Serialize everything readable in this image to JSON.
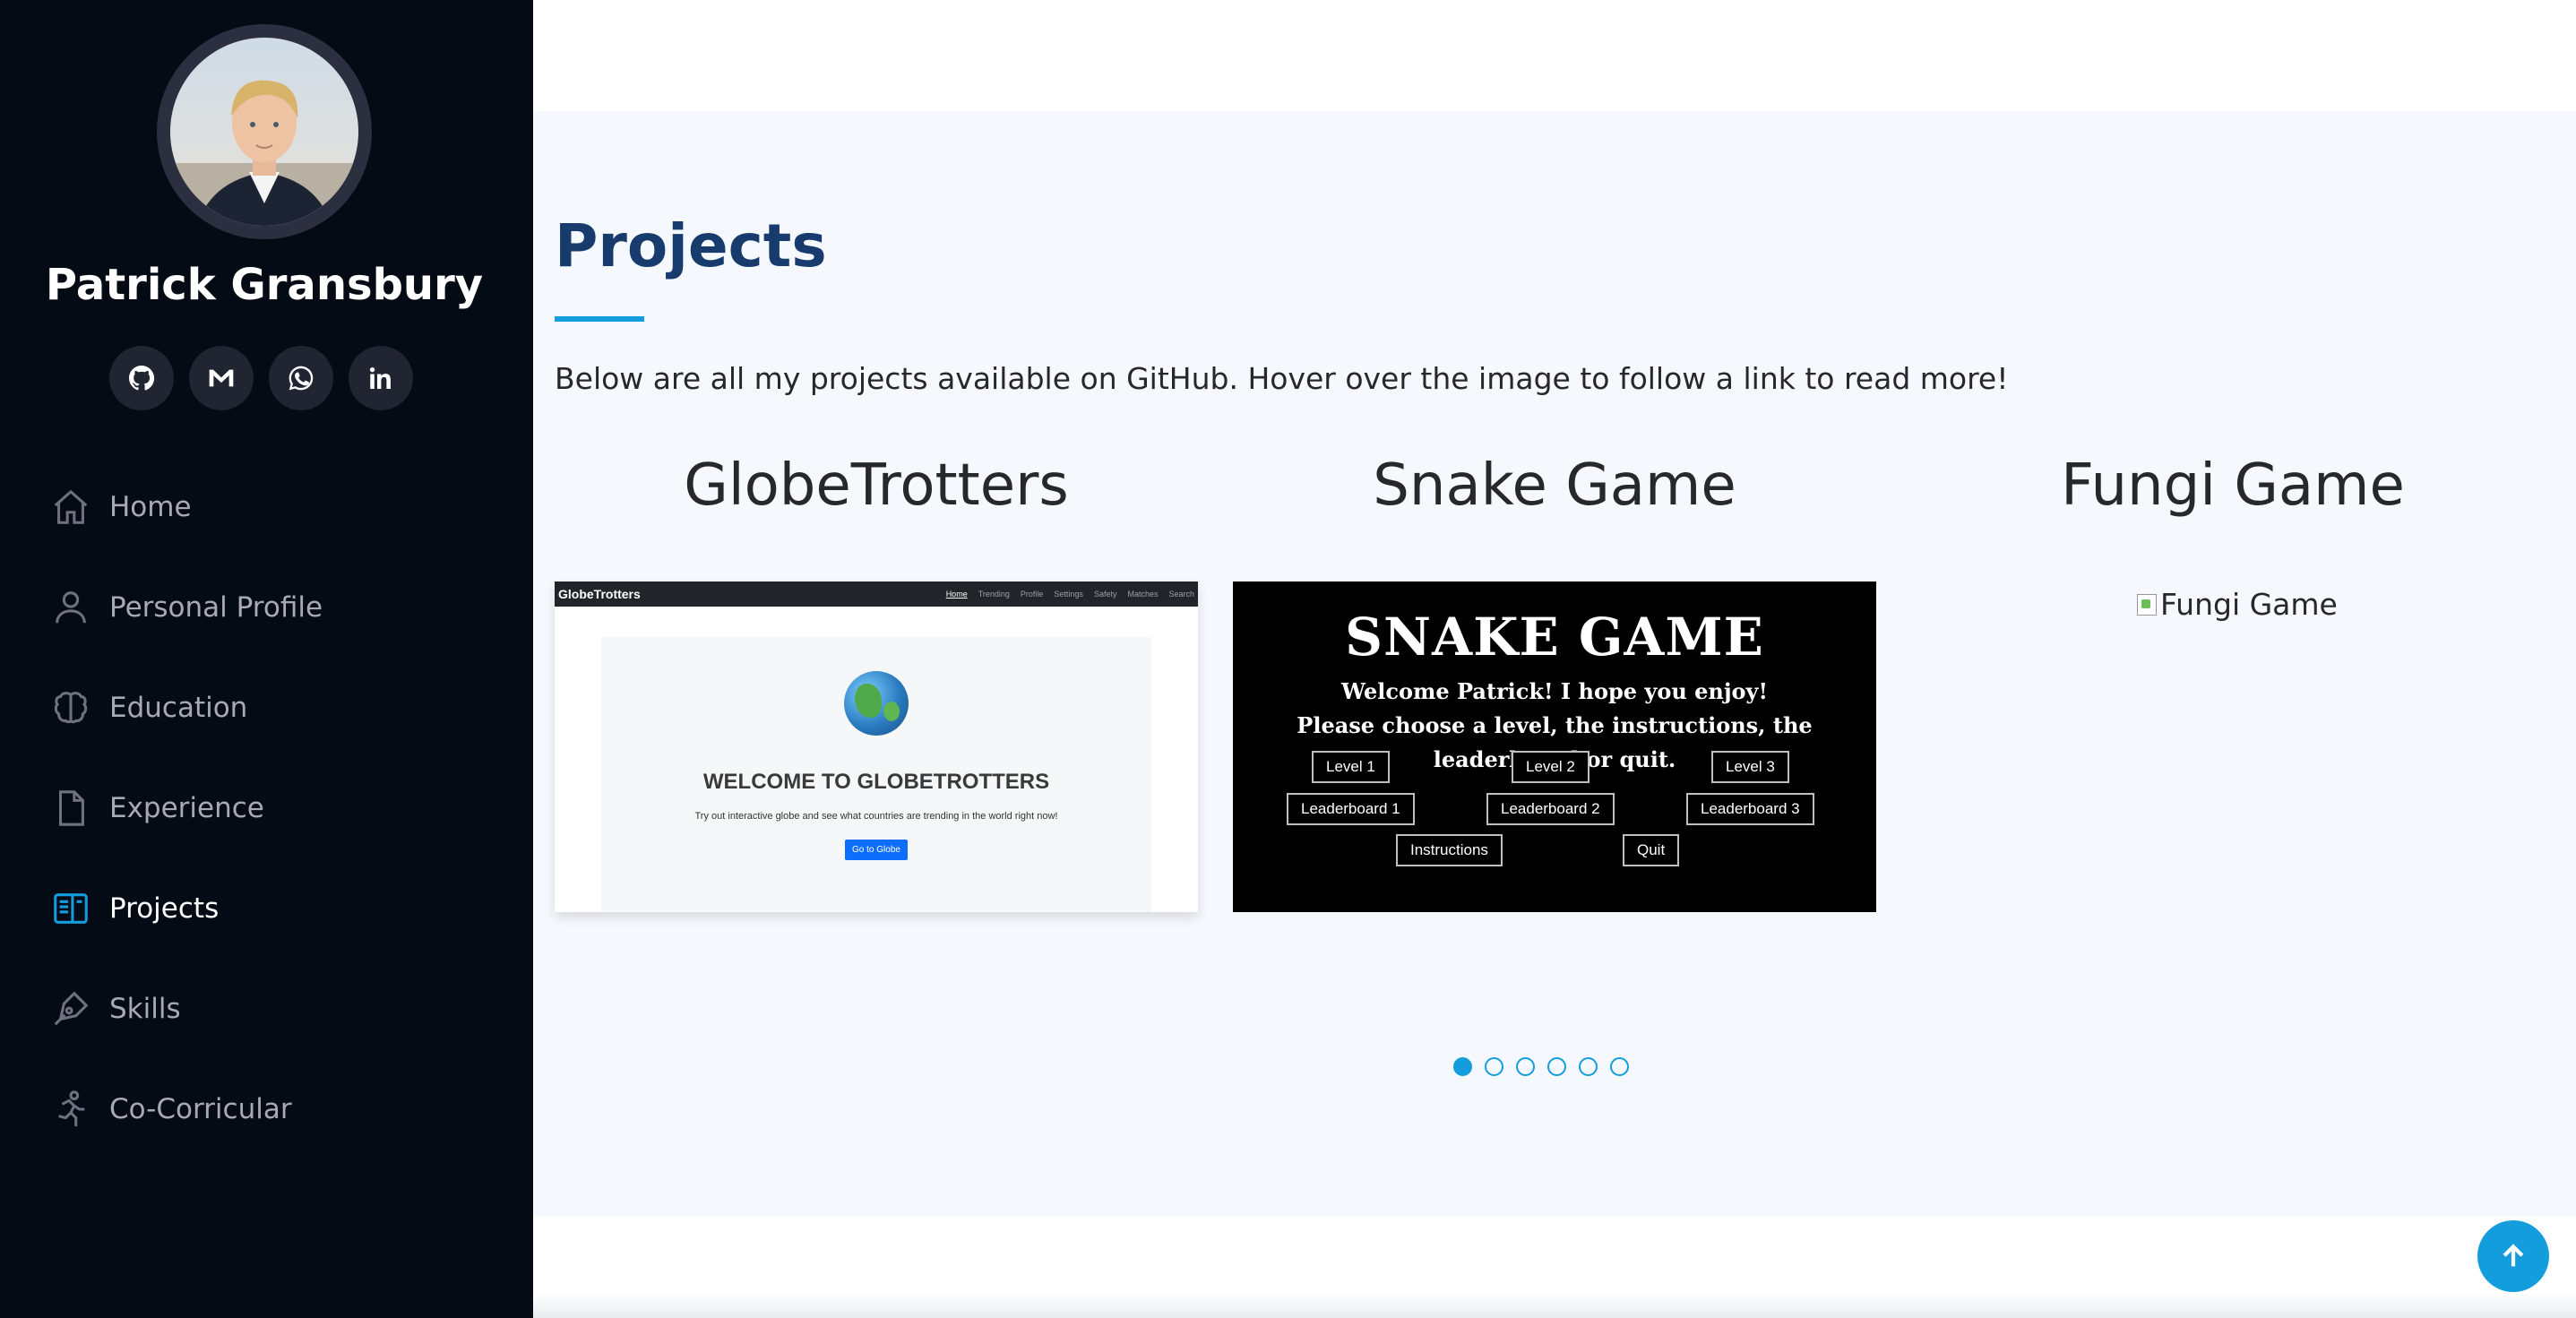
{
  "sidebar": {
    "profile_name": "Patrick Gransbury",
    "socials": [
      {
        "icon": "github-icon"
      },
      {
        "icon": "gmail-icon"
      },
      {
        "icon": "whatsapp-icon"
      },
      {
        "icon": "linkedin-icon"
      }
    ],
    "nav": [
      {
        "label": "Home",
        "icon": "home-icon",
        "active": false
      },
      {
        "label": "Personal Profile",
        "icon": "person-icon",
        "active": false
      },
      {
        "label": "Education",
        "icon": "brain-icon",
        "active": false
      },
      {
        "label": "Experience",
        "icon": "document-icon",
        "active": false
      },
      {
        "label": "Projects",
        "icon": "layout-icon",
        "active": true
      },
      {
        "label": "Skills",
        "icon": "pen-icon",
        "active": false
      },
      {
        "label": "Co-Corricular",
        "icon": "running-icon",
        "active": false
      }
    ]
  },
  "projects": {
    "title": "Projects",
    "intro": "Below are all my projects available on GitHub. Hover over the image to follow a link to read more!",
    "items": [
      {
        "title": "GlobeTrotters",
        "screenshot": {
          "brand": "GlobeTrotters",
          "nav_links": [
            "Home",
            "Trending",
            "Profile",
            "Settings",
            "Safety",
            "Matches",
            "Search"
          ],
          "heading": "WELCOME TO GLOBETROTTERS",
          "subtext": "Try out interactive globe and see what countries are trending in the world right now!",
          "button": "Go to Globe"
        }
      },
      {
        "title": "Snake Game",
        "screenshot": {
          "heading": "SNAKE GAME",
          "line1": "Welcome Patrick! I hope you enjoy!",
          "line2": "Please choose a level, the instructions, the leaderboard or quit.",
          "buttons": [
            "Level 1",
            "Level 2",
            "Level 3",
            "Leaderboard 1",
            "Leaderboard 2",
            "Leaderboard 3",
            "Instructions",
            "Quit"
          ]
        }
      },
      {
        "title": "Fungi Game",
        "image_alt": "Fungi Game"
      }
    ],
    "carousel_pages": 6,
    "carousel_active": 1
  },
  "colors": {
    "sidebar_bg": "#040b14",
    "accent": "#149ddd",
    "section_bg": "#f5f8fd",
    "heading": "#173b6c"
  }
}
